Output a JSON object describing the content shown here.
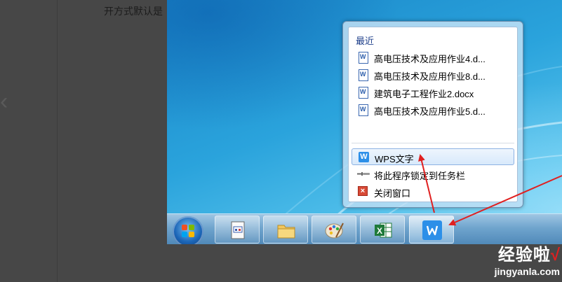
{
  "background": {
    "text_fragment": "开方式默认是"
  },
  "jumplist": {
    "recent_heading": "最近",
    "recent_items": [
      {
        "label": "高电压技术及应用作业4.d..."
      },
      {
        "label": "高电压技术及应用作业8.d..."
      },
      {
        "label": "建筑电子工程作业2.docx"
      },
      {
        "label": "高电压技术及应用作业5.d..."
      }
    ],
    "tasks": {
      "open_app": "WPS文字",
      "pin": "将此程序锁定到任务栏",
      "close": "关闭窗口"
    }
  },
  "taskbar": {
    "items": [
      "start-orb",
      "document-viewer",
      "file-explorer",
      "paint",
      "excel",
      "wps-writer"
    ]
  },
  "colors": {
    "accent_wps": "#2c8fe8",
    "excel_green": "#1f7a3a",
    "annotation_arrow": "#e02020"
  },
  "watermark": {
    "cn": "经验啦",
    "check": "√",
    "url": "jingyanla.com"
  }
}
